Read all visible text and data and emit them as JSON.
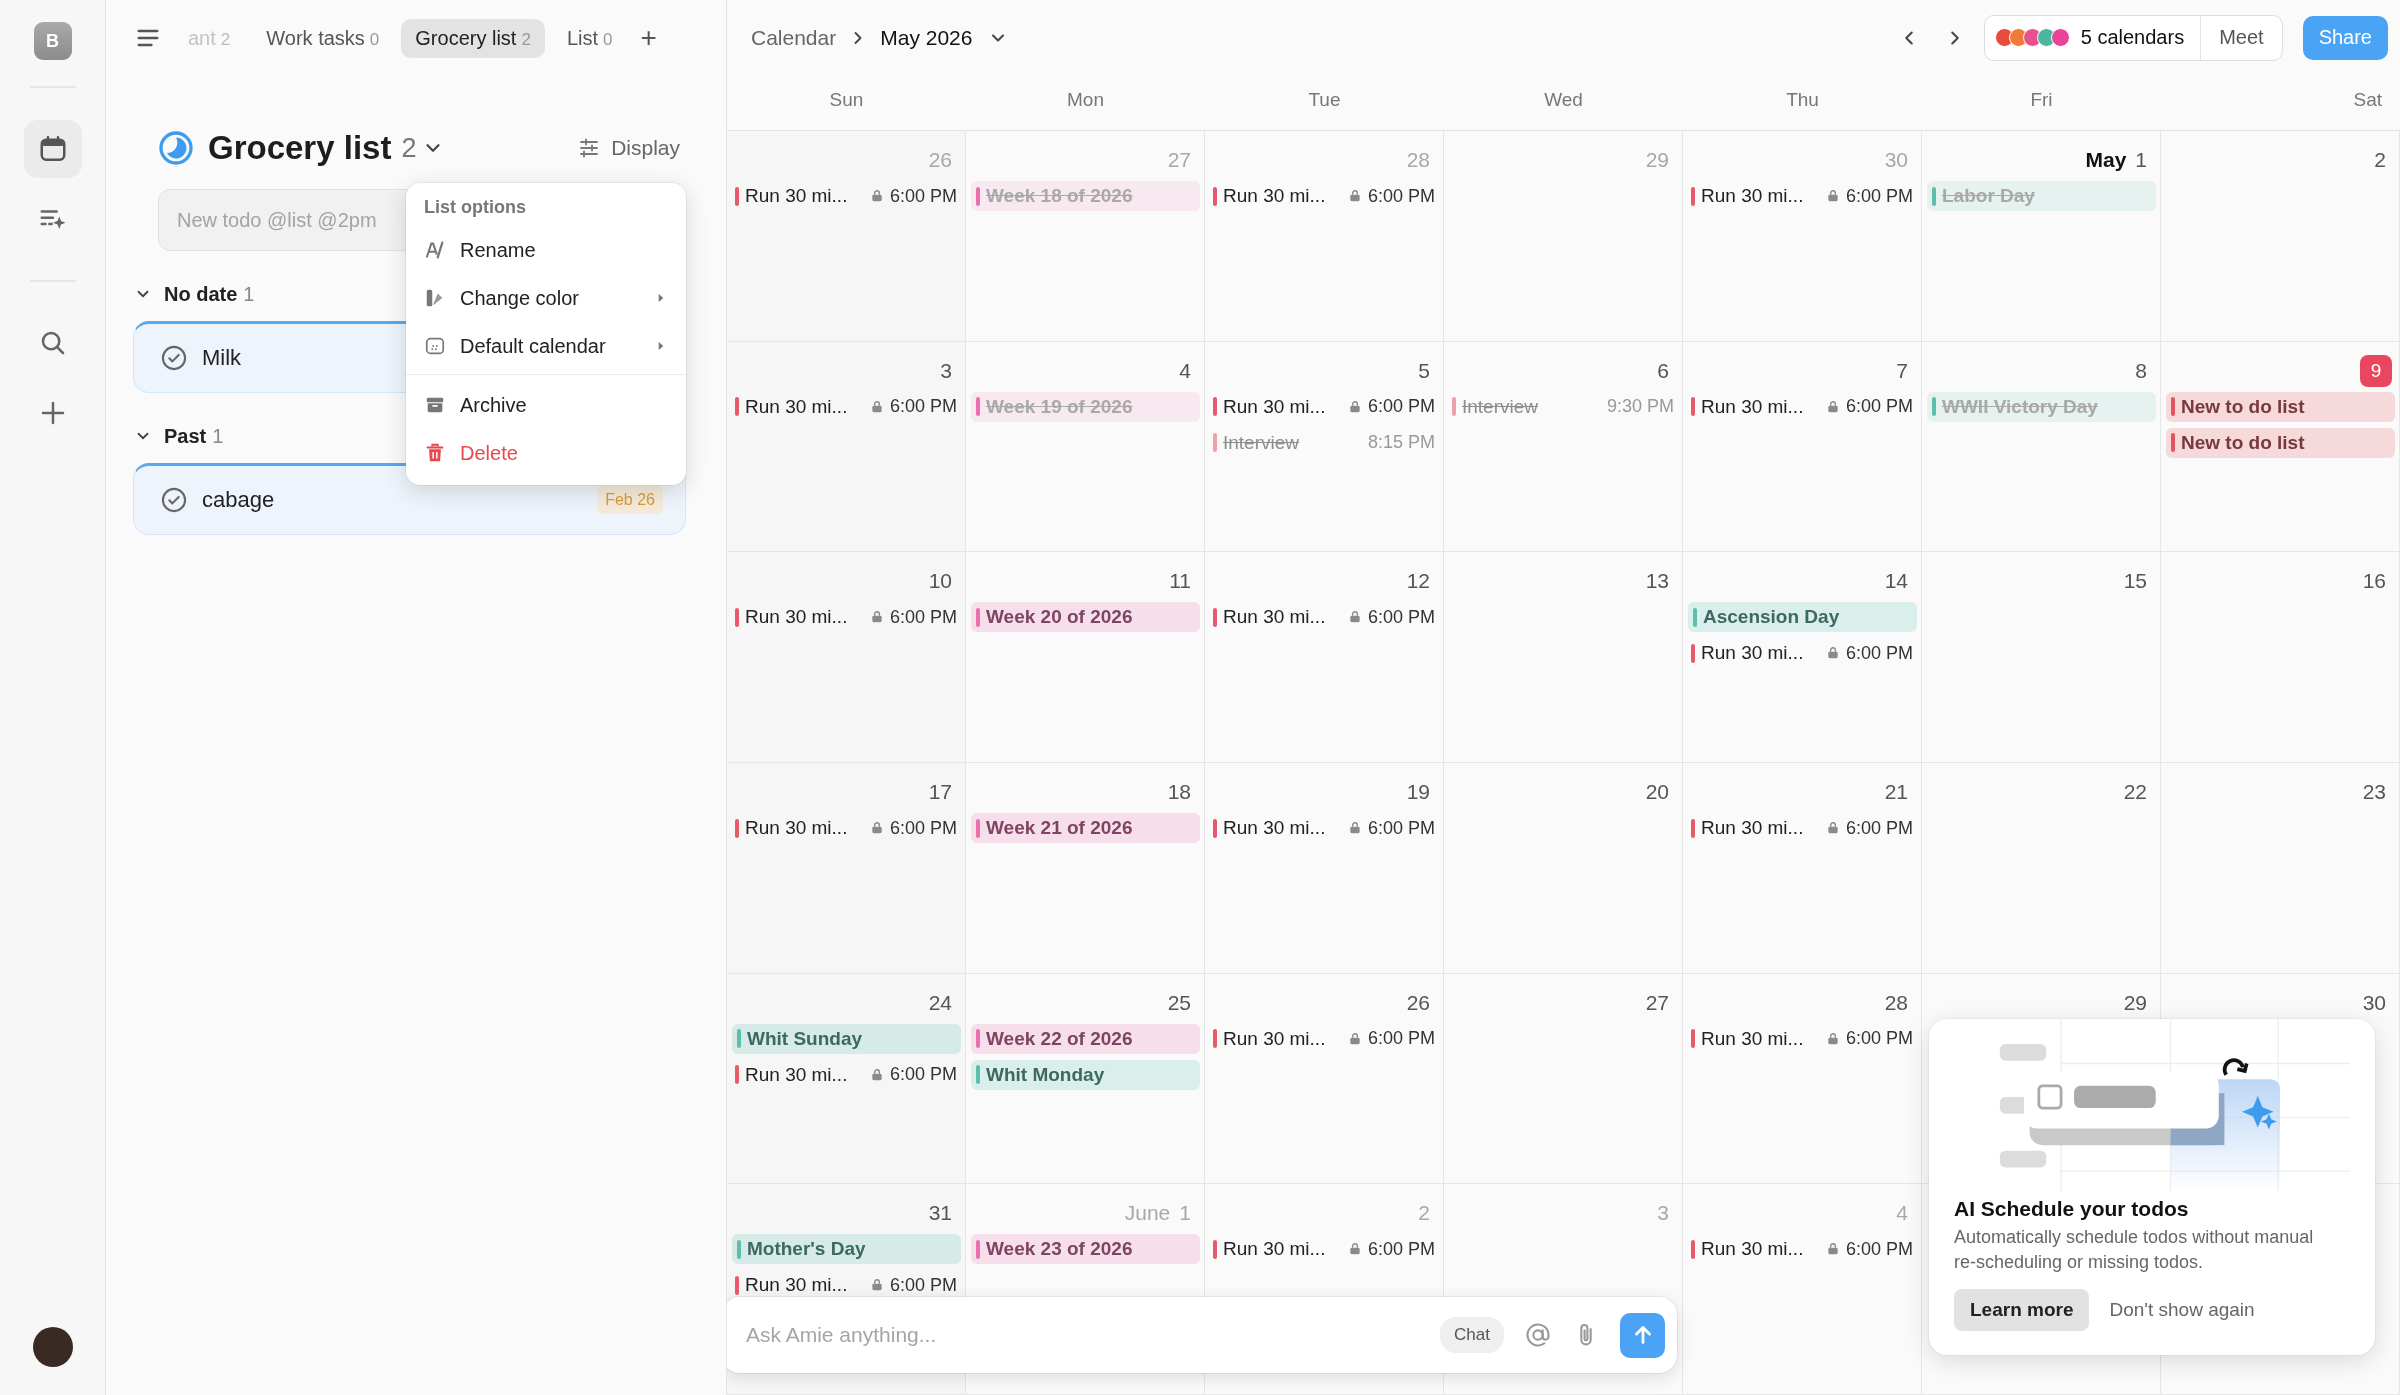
{
  "rail": {
    "avatar": "B",
    "items": [
      {
        "kind": "calendar",
        "selected": true
      },
      {
        "kind": "ai-todos",
        "selected": false
      },
      {
        "kind": "search",
        "selected": false
      },
      {
        "kind": "add",
        "selected": false
      }
    ]
  },
  "todo_panel": {
    "tabs": [
      {
        "label": "ant",
        "count": "2",
        "selected": false,
        "clipped": true
      },
      {
        "label": "Work tasks",
        "count": "0",
        "selected": false,
        "clipped": false
      },
      {
        "label": "Grocery list",
        "count": "2",
        "selected": true,
        "clipped": false
      },
      {
        "label": "List",
        "count": "0",
        "selected": false,
        "clipped": false
      }
    ],
    "add_tab": "+",
    "title": "Grocery list",
    "count": "2",
    "display_button": "Display",
    "new_todo": {
      "placeholder": "New todo @list @2pm"
    },
    "groups": [
      {
        "label": "No date",
        "count": "1",
        "expanded": true,
        "items": [
          {
            "title": "Milk"
          }
        ]
      },
      {
        "label": "Past",
        "count": "1",
        "expanded": true,
        "items": [
          {
            "title": "cabage",
            "date": "Feb 26"
          }
        ]
      }
    ],
    "menu": {
      "header": "List options",
      "items": [
        {
          "kind": "rename",
          "label": "Rename",
          "submenu": false,
          "divider_before": false
        },
        {
          "kind": "color",
          "label": "Change color",
          "submenu": true,
          "divider_before": false
        },
        {
          "kind": "calendar",
          "label": "Default calendar",
          "submenu": true,
          "divider_before": false
        },
        {
          "kind": "archive",
          "label": "Archive",
          "submenu": false,
          "divider_before": true
        },
        {
          "kind": "delete",
          "label": "Delete",
          "submenu": false,
          "divider_before": false
        }
      ]
    }
  },
  "calendar": {
    "breadcrumb": "Calendar",
    "month": "May 2026",
    "calendars": {
      "label": "5 calendars",
      "dots": [
        {
          "color": "#e84c3d"
        },
        {
          "color": "#f07a3a"
        },
        {
          "color": "#e8508f"
        },
        {
          "color": "#4db6a0"
        },
        {
          "color": "#e8449a"
        }
      ]
    },
    "meet_button": "Meet",
    "share_button": "Share",
    "weekdays": [
      "Sun",
      "Mon",
      "Tue",
      "Wed",
      "Thu",
      "Fri",
      "Sat"
    ],
    "weeks": [
      {
        "days": [
          {
            "date": "26",
            "muted": true,
            "today": false,
            "events": [
              {
                "kind": "timed",
                "title": "Run 30 mi...",
                "time": "6:00 PM",
                "locked": true,
                "color": "#e8596a",
                "done": false
              }
            ]
          },
          {
            "date": "27",
            "muted": true,
            "today": false,
            "events": [
              {
                "kind": "allday",
                "title": "Week 18 of 2026",
                "color": "#ec6fb0",
                "done": true
              }
            ]
          },
          {
            "date": "28",
            "muted": true,
            "today": false,
            "events": [
              {
                "kind": "timed",
                "title": "Run 30 mi...",
                "time": "6:00 PM",
                "locked": true,
                "color": "#e8596a",
                "done": false
              }
            ]
          },
          {
            "date": "29",
            "muted": true,
            "today": false
          },
          {
            "date": "30",
            "muted": true,
            "today": false,
            "events": [
              {
                "kind": "timed",
                "title": "Run 30 mi...",
                "time": "6:00 PM",
                "locked": true,
                "color": "#e8596a",
                "done": false
              }
            ]
          },
          {
            "month": "May",
            "date": "1",
            "muted": false,
            "today": false,
            "events": [
              {
                "kind": "allday",
                "title": "Labor Day",
                "color": "#5cbfae",
                "done": true
              }
            ]
          },
          {
            "date": "2",
            "muted": false,
            "today": false
          }
        ]
      },
      {
        "days": [
          {
            "date": "3",
            "muted": false,
            "today": false,
            "events": [
              {
                "kind": "timed",
                "title": "Run 30 mi...",
                "time": "6:00 PM",
                "locked": true,
                "color": "#e8596a",
                "done": false
              }
            ]
          },
          {
            "date": "4",
            "muted": false,
            "today": false,
            "events": [
              {
                "kind": "allday",
                "title": "Week 19 of 2026",
                "color": "#ec6fb0",
                "done": true
              }
            ]
          },
          {
            "date": "5",
            "muted": false,
            "today": false,
            "events": [
              {
                "kind": "timed",
                "title": "Run 30 mi...",
                "time": "6:00 PM",
                "locked": true,
                "color": "#e8596a",
                "done": false
              },
              {
                "kind": "timed",
                "title": "Interview",
                "time": "8:15 PM",
                "locked": false,
                "color": "#f0a0a8",
                "done": true
              }
            ]
          },
          {
            "date": "6",
            "muted": false,
            "today": false,
            "events": [
              {
                "kind": "timed",
                "title": "Interview",
                "time": "9:30 PM",
                "locked": false,
                "color": "#f0a0a8",
                "done": true
              }
            ]
          },
          {
            "date": "7",
            "muted": false,
            "today": false,
            "events": [
              {
                "kind": "timed",
                "title": "Run 30 mi...",
                "time": "6:00 PM",
                "locked": true,
                "color": "#e8596a",
                "done": false
              }
            ]
          },
          {
            "date": "8",
            "muted": false,
            "today": false,
            "events": [
              {
                "kind": "allday",
                "title": "WWII Victory Day",
                "color": "#5cbfae",
                "done": true
              }
            ]
          },
          {
            "date": "9",
            "muted": false,
            "today": true,
            "events": [
              {
                "kind": "allday",
                "title": "New to do list",
                "color": "#e05561",
                "done": false
              },
              {
                "kind": "allday",
                "title": "New to do list",
                "color": "#e05561",
                "done": false
              }
            ]
          }
        ]
      },
      {
        "days": [
          {
            "date": "10",
            "muted": false,
            "today": false,
            "events": [
              {
                "kind": "timed",
                "title": "Run 30 mi...",
                "time": "6:00 PM",
                "locked": true,
                "color": "#e8596a",
                "done": false
              }
            ]
          },
          {
            "date": "11",
            "muted": false,
            "today": false,
            "events": [
              {
                "kind": "allday",
                "title": "Week 20 of 2026",
                "color": "#ec6fb0",
                "done": false
              }
            ]
          },
          {
            "date": "12",
            "muted": false,
            "today": false,
            "events": [
              {
                "kind": "timed",
                "title": "Run 30 mi...",
                "time": "6:00 PM",
                "locked": true,
                "color": "#e8596a",
                "done": false
              }
            ]
          },
          {
            "date": "13",
            "muted": false,
            "today": false
          },
          {
            "date": "14",
            "muted": false,
            "today": false,
            "events": [
              {
                "kind": "allday",
                "title": "Ascension Day",
                "color": "#5cbfae",
                "done": false
              },
              {
                "kind": "timed",
                "title": "Run 30 mi...",
                "time": "6:00 PM",
                "locked": true,
                "color": "#e8596a",
                "done": false
              }
            ]
          },
          {
            "date": "15",
            "muted": false,
            "today": false
          },
          {
            "date": "16",
            "muted": false,
            "today": false
          }
        ]
      },
      {
        "days": [
          {
            "date": "17",
            "muted": false,
            "today": false,
            "events": [
              {
                "kind": "timed",
                "title": "Run 30 mi...",
                "time": "6:00 PM",
                "locked": true,
                "color": "#e8596a",
                "done": false
              }
            ]
          },
          {
            "date": "18",
            "muted": false,
            "today": false,
            "events": [
              {
                "kind": "allday",
                "title": "Week 21 of 2026",
                "color": "#ec6fb0",
                "done": false
              }
            ]
          },
          {
            "date": "19",
            "muted": false,
            "today": false,
            "events": [
              {
                "kind": "timed",
                "title": "Run 30 mi...",
                "time": "6:00 PM",
                "locked": true,
                "color": "#e8596a",
                "done": false
              }
            ]
          },
          {
            "date": "20",
            "muted": false,
            "today": false
          },
          {
            "date": "21",
            "muted": false,
            "today": false,
            "events": [
              {
                "kind": "timed",
                "title": "Run 30 mi...",
                "time": "6:00 PM",
                "locked": true,
                "color": "#e8596a",
                "done": false
              }
            ]
          },
          {
            "date": "22",
            "muted": false,
            "today": false
          },
          {
            "date": "23",
            "muted": false,
            "today": false
          }
        ]
      },
      {
        "days": [
          {
            "date": "24",
            "muted": false,
            "today": false,
            "events": [
              {
                "kind": "allday",
                "title": "Whit Sunday",
                "color": "#5cbfae",
                "done": false
              },
              {
                "kind": "timed",
                "title": "Run 30 mi...",
                "time": "6:00 PM",
                "locked": true,
                "color": "#e8596a",
                "done": false
              }
            ]
          },
          {
            "date": "25",
            "muted": false,
            "today": false,
            "events": [
              {
                "kind": "allday",
                "title": "Week 22 of 2026",
                "color": "#ec6fb0",
                "done": false
              },
              {
                "kind": "allday",
                "title": "Whit Monday",
                "color": "#5cbfae",
                "done": false
              }
            ]
          },
          {
            "date": "26",
            "muted": false,
            "today": false,
            "events": [
              {
                "kind": "timed",
                "title": "Run 30 mi...",
                "time": "6:00 PM",
                "locked": true,
                "color": "#e8596a",
                "done": false
              }
            ]
          },
          {
            "date": "27",
            "muted": false,
            "today": false
          },
          {
            "date": "28",
            "muted": false,
            "today": false,
            "events": [
              {
                "kind": "timed",
                "title": "Run 30 mi...",
                "time": "6:00 PM",
                "locked": true,
                "color": "#e8596a",
                "done": false
              }
            ]
          },
          {
            "date": "29",
            "muted": false,
            "today": false
          },
          {
            "date": "30",
            "muted": false,
            "today": false
          }
        ]
      },
      {
        "days": [
          {
            "date": "31",
            "muted": false,
            "today": false,
            "events": [
              {
                "kind": "allday",
                "title": "Mother's Day",
                "color": "#5cbfae",
                "done": false
              },
              {
                "kind": "timed",
                "title": "Run 30 mi...",
                "time": "6:00 PM",
                "locked": true,
                "color": "#e8596a",
                "done": false
              }
            ]
          },
          {
            "month": "June",
            "date": "1",
            "muted": true,
            "today": false,
            "events": [
              {
                "kind": "allday",
                "title": "Week 23 of 2026",
                "color": "#ec6fb0",
                "done": false
              }
            ]
          },
          {
            "date": "2",
            "muted": true,
            "today": false,
            "events": [
              {
                "kind": "timed",
                "title": "Run 30 mi...",
                "time": "6:00 PM",
                "locked": true,
                "color": "#e8596a",
                "done": false
              }
            ]
          },
          {
            "date": "3",
            "muted": true,
            "today": false
          },
          {
            "date": "4",
            "muted": true,
            "today": false,
            "events": [
              {
                "kind": "timed",
                "title": "Run 30 mi...",
                "time": "6:00 PM",
                "locked": true,
                "color": "#e8596a",
                "done": false
              }
            ]
          }
        ]
      }
    ],
    "chat": {
      "placeholder": "Ask Amie anything...",
      "mode_chip": "Chat"
    },
    "promo": {
      "title": "AI Schedule your todos",
      "text": "Automatically schedule todos without manual re-scheduling or missing todos.",
      "primary_button": "Learn more",
      "secondary_button": "Don't show again"
    }
  }
}
